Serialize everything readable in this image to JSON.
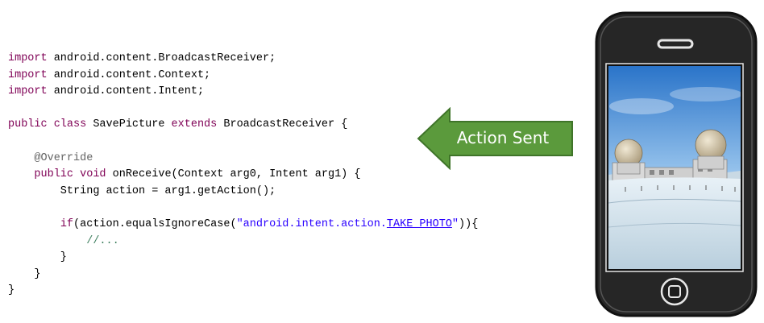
{
  "code": {
    "lines": [
      [
        {
          "t": "import",
          "c": "kw"
        },
        {
          "t": " android.content.BroadcastReceiver;"
        }
      ],
      [
        {
          "t": "import",
          "c": "kw"
        },
        {
          "t": " android.content.Context;"
        }
      ],
      [
        {
          "t": "import",
          "c": "kw"
        },
        {
          "t": " android.content.Intent;"
        }
      ],
      [],
      [
        {
          "t": "public class",
          "c": "kw"
        },
        {
          "t": " SavePicture "
        },
        {
          "t": "extends",
          "c": "kw"
        },
        {
          "t": " BroadcastReceiver {"
        }
      ],
      [],
      [
        {
          "t": "    "
        },
        {
          "t": "@Override",
          "c": "ann"
        }
      ],
      [
        {
          "t": "    "
        },
        {
          "t": "public void",
          "c": "kw"
        },
        {
          "t": " onReceive(Context arg0, Intent arg1) {"
        }
      ],
      [
        {
          "t": "        String action = arg1.getAction();"
        }
      ],
      [],
      [
        {
          "t": "        "
        },
        {
          "t": "if",
          "c": "kw"
        },
        {
          "t": "(action.equalsIgnoreCase("
        },
        {
          "t": "\"android.intent.action.",
          "c": "str"
        },
        {
          "t": "TAKE_PHOTO",
          "c": "str underline"
        },
        {
          "t": "\"",
          "c": "str"
        },
        {
          "t": ")){"
        }
      ],
      [
        {
          "t": "            "
        },
        {
          "t": "//...",
          "c": "cmt"
        }
      ],
      [
        {
          "t": "        }"
        }
      ],
      [
        {
          "t": "    }"
        }
      ],
      [
        {
          "t": "}"
        }
      ]
    ]
  },
  "callout": {
    "label": "Action Sent",
    "color": "#5b9a3c"
  },
  "phone": {
    "screen": "snowy-landscape-radomes-photo"
  }
}
